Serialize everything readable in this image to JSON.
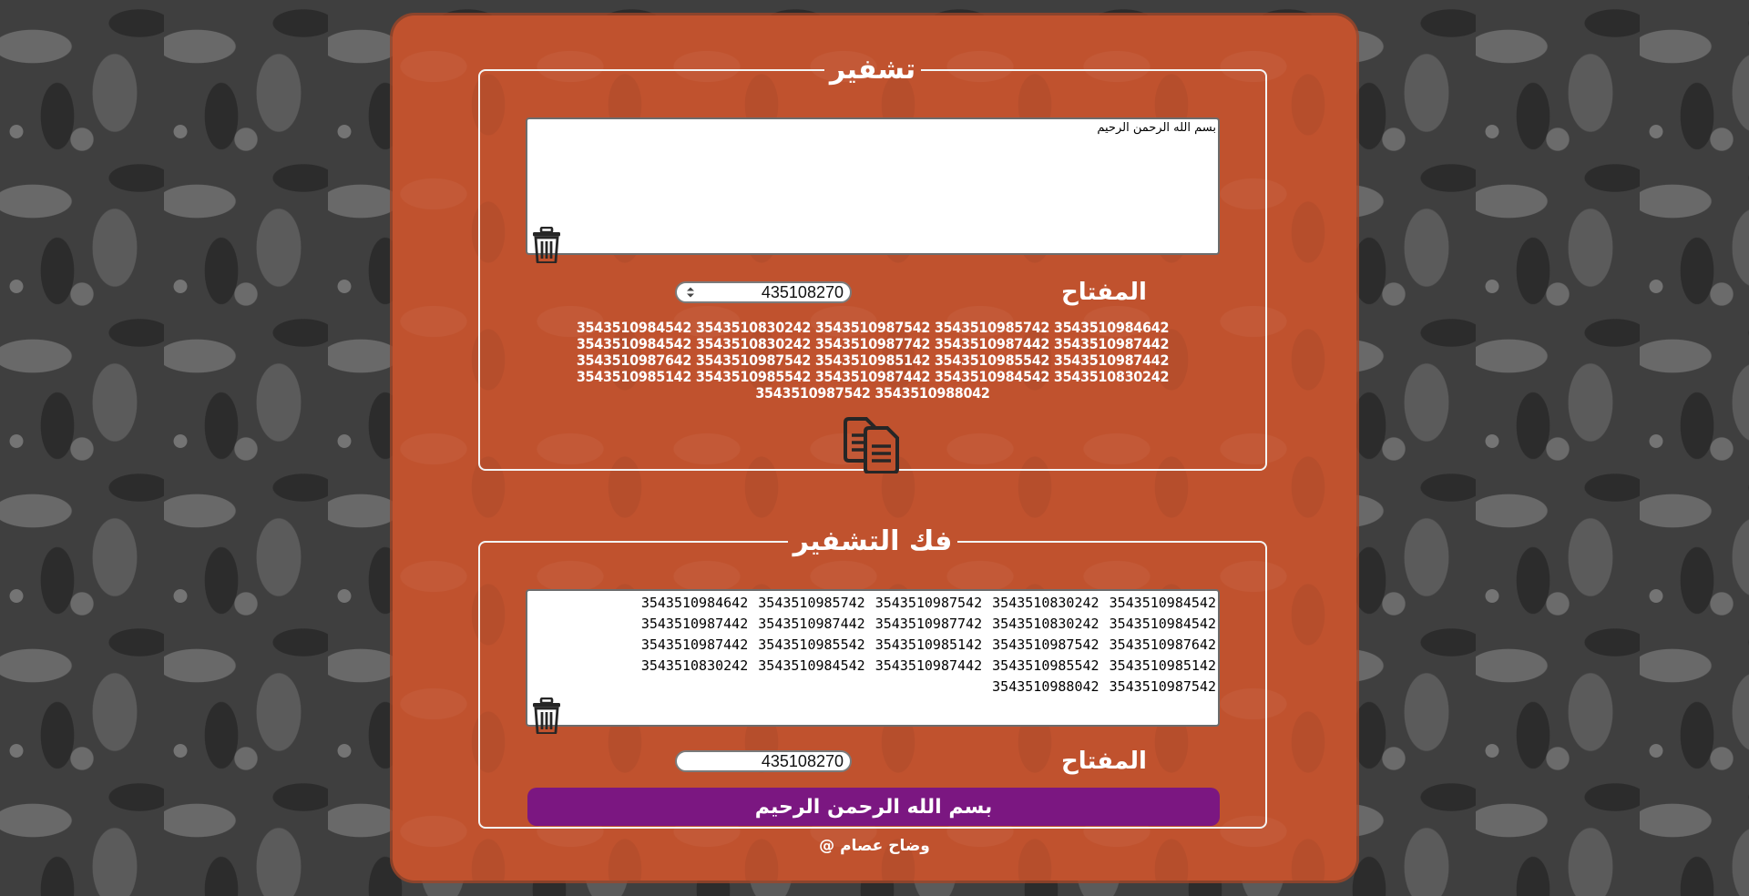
{
  "encrypt": {
    "title": "تشفير",
    "input_text": "بسم الله الرحمن الرحيم",
    "key_label": "المفتاح",
    "key_value": "435108270",
    "output": "3543510984542 3543510830242 3543510987542 3543510985742 3543510984642 3543510984542 3543510830242 3543510987742 3543510987442 3543510987442 3543510987642 3543510987542 3543510985142 3543510985542 3543510987442 3543510985142 3543510985542 3543510987442 3543510984542 3543510830242 3543510987542 3543510988042",
    "trash_icon": "trash-icon",
    "copy_icon": "copy-icon",
    "spinner_icon": "spinner-icon"
  },
  "decrypt": {
    "title": "فك التشفير",
    "input_text": "3543510984542 3543510830242 3543510987542 3543510985742 3543510984642 3543510984542 3543510830242 3543510987742 3543510987442 3543510987442 3543510987642 3543510987542 3543510985142 3543510985542 3543510987442 3543510985142 3543510985542 3543510987442 3543510984542 3543510830242 3543510987542 3543510988042",
    "key_label": "المفتاح",
    "key_value": "435108270",
    "result": "بسم الله الرحمن الرحيم",
    "trash_icon": "trash-icon"
  },
  "footer": {
    "text": "@ وضاح عصام"
  },
  "colors": {
    "panel": "#c0522e",
    "button": "#7b1781",
    "background": "#3f3f3f"
  }
}
